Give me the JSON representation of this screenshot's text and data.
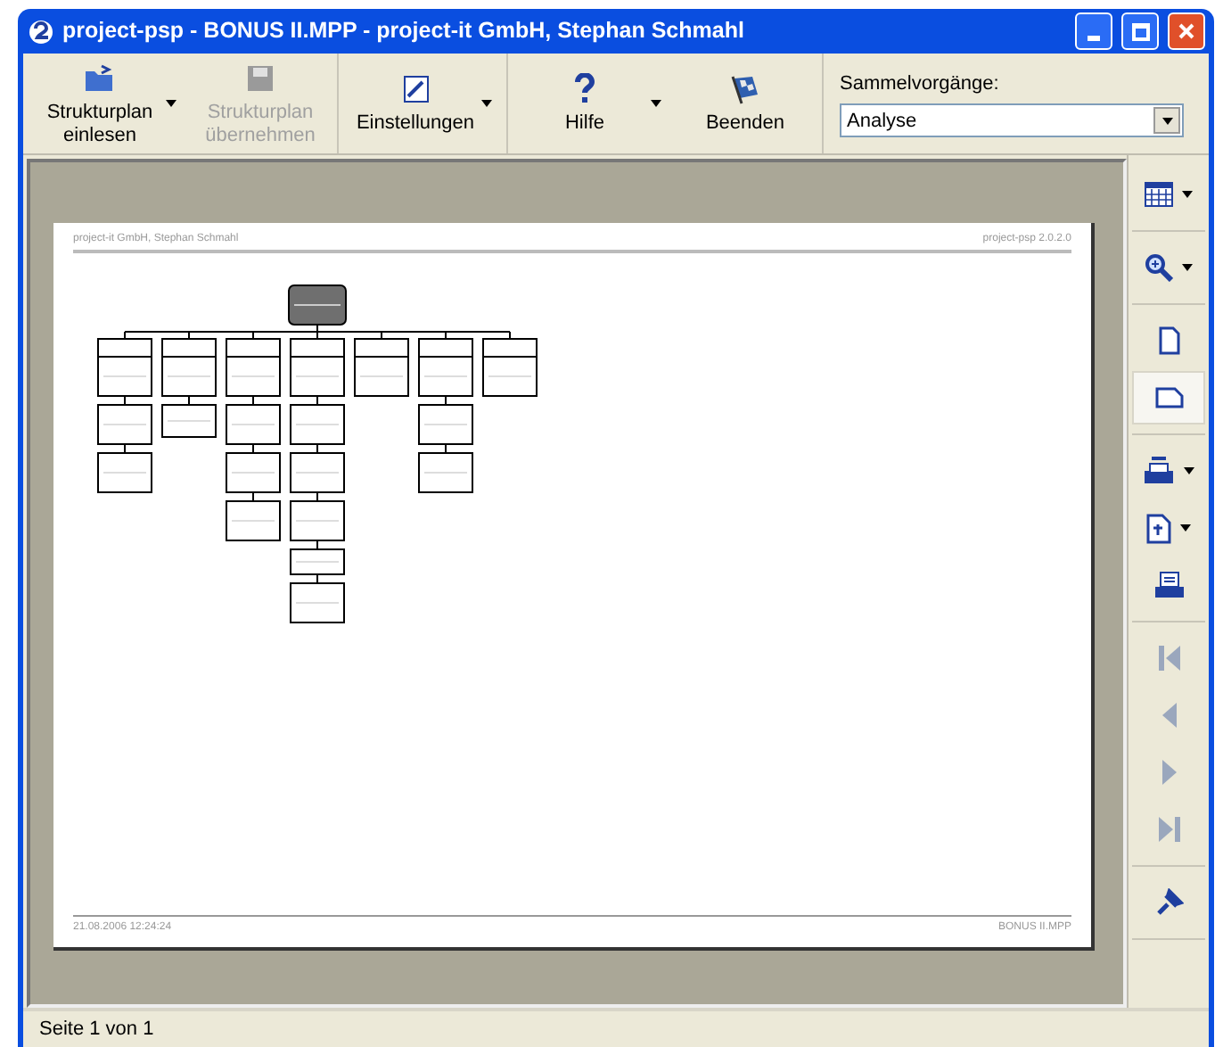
{
  "window": {
    "title": "project-psp - BONUS II.MPP - project-it GmbH, Stephan Schmahl"
  },
  "toolbar": [
    {
      "kind": "open",
      "label": "Strukturplan einlesen",
      "dropdown": true,
      "disabled": false
    },
    {
      "kind": "save",
      "label": "Strukturplan übernehmen",
      "dropdown": false,
      "disabled": true
    },
    {
      "kind": "settings",
      "label": "Einstellungen",
      "dropdown": true,
      "disabled": false
    },
    {
      "kind": "help",
      "label": "Hilfe",
      "dropdown": true,
      "disabled": false
    },
    {
      "kind": "exit",
      "label": "Beenden",
      "dropdown": false,
      "disabled": false
    }
  ],
  "collective": {
    "label": "Sammelvorgänge:",
    "value": "Analyse"
  },
  "page": {
    "header_left": "project-it GmbH, Stephan Schmahl",
    "header_right": "project-psp 2.0.2.0",
    "footer_left": "21.08.2006 12:24:24",
    "footer_right": "BONUS II.MPP"
  },
  "side_toolbar": [
    [
      {
        "kind": "table",
        "dropdown": true,
        "selected": false,
        "disabled": false
      }
    ],
    [
      {
        "kind": "zoom",
        "dropdown": true,
        "selected": false,
        "disabled": false
      }
    ],
    [
      {
        "kind": "portrait",
        "dropdown": false,
        "selected": false,
        "disabled": false
      },
      {
        "kind": "landscape",
        "dropdown": false,
        "selected": true,
        "disabled": false
      }
    ],
    [
      {
        "kind": "printsetup",
        "dropdown": true,
        "selected": false,
        "disabled": false
      },
      {
        "kind": "export",
        "dropdown": true,
        "selected": false,
        "disabled": false
      },
      {
        "kind": "print",
        "dropdown": false,
        "selected": false,
        "disabled": false
      }
    ],
    [
      {
        "kind": "first",
        "dropdown": false,
        "selected": false,
        "disabled": true
      },
      {
        "kind": "previous",
        "dropdown": false,
        "selected": false,
        "disabled": true
      },
      {
        "kind": "next",
        "dropdown": false,
        "selected": false,
        "disabled": true
      },
      {
        "kind": "last",
        "dropdown": false,
        "selected": false,
        "disabled": true
      }
    ],
    [
      {
        "kind": "pin",
        "dropdown": false,
        "selected": false,
        "disabled": false
      }
    ]
  ],
  "status_bar": {
    "text": "Seite 1 von 1"
  }
}
